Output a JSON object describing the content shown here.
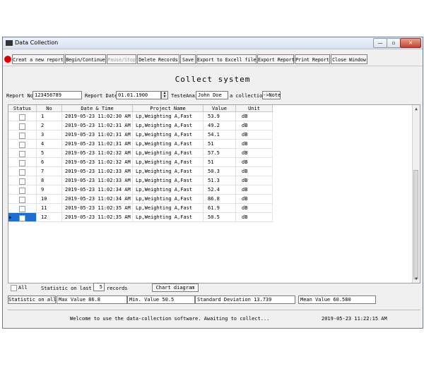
{
  "window": {
    "title": "Data Collection",
    "min": "—",
    "max": "▫",
    "close": "✕"
  },
  "toolbar": {
    "create": "Creat a new report",
    "begin": "Begin/Continue",
    "pause": "Pause/Stop",
    "delete": "Delete Records",
    "save": "Save",
    "export_excel": "Export to Excell file",
    "export_report": "Export Report",
    "print_report": "Print Report",
    "close_window": "Close Window"
  },
  "heading": "Collect system",
  "form": {
    "report_no_label": "Report No",
    "report_no_value": "123456789",
    "report_date_label": "Report Date",
    "report_date_value": "01.01.1900",
    "tester_label": "TesteAnai",
    "tester_value": "John Doe",
    "collection_label": "a collection",
    "note_button": "->Note"
  },
  "table": {
    "headers": [
      "Status",
      "No",
      "Date & Time",
      "Project Name",
      "Value",
      "Unit"
    ],
    "rows": [
      {
        "no": "1",
        "dt": "2019-05-23 11:02:30 AM",
        "project": "Lp,Weighting A,Fast",
        "value": "53.9",
        "unit": "dB"
      },
      {
        "no": "2",
        "dt": "2019-05-23 11:02:31 AM",
        "project": "Lp,Weighting A,Fast",
        "value": "49.2",
        "unit": "dB"
      },
      {
        "no": "3",
        "dt": "2019-05-23 11:02:31 AM",
        "project": "Lp,Weighting A,Fast",
        "value": "54.1",
        "unit": "dB"
      },
      {
        "no": "4",
        "dt": "2019-05-23 11:02:31 AM",
        "project": "Lp,Weighting A,Fast",
        "value": "51",
        "unit": "dB"
      },
      {
        "no": "5",
        "dt": "2019-05-23 11:02:32 AM",
        "project": "Lp,Weighting A,Fast",
        "value": "57.5",
        "unit": "dB"
      },
      {
        "no": "6",
        "dt": "2019-05-23 11:02:32 AM",
        "project": "Lp,Weighting A,Fast",
        "value": "51",
        "unit": "dB"
      },
      {
        "no": "7",
        "dt": "2019-05-23 11:02:33 AM",
        "project": "Lp,Weighting A,Fast",
        "value": "50.3",
        "unit": "dB"
      },
      {
        "no": "8",
        "dt": "2019-05-23 11:02:33 AM",
        "project": "Lp,Weighting A,Fast",
        "value": "51.3",
        "unit": "dB"
      },
      {
        "no": "9",
        "dt": "2019-05-23 11:02:34 AM",
        "project": "Lp,Weighting A,Fast",
        "value": "52.4",
        "unit": "dB"
      },
      {
        "no": "10",
        "dt": "2019-05-23 11:02:34 AM",
        "project": "Lp,Weighting A,Fast",
        "value": "86.8",
        "unit": "dB"
      },
      {
        "no": "11",
        "dt": "2019-05-23 11:02:35 AM",
        "project": "Lp,Weighting A,Fast",
        "value": "61.9",
        "unit": "dB"
      },
      {
        "no": "12",
        "dt": "2019-05-23 11:02:35 AM",
        "project": "Lp,Weighting A,Fast",
        "value": "50.5",
        "unit": "dB"
      }
    ]
  },
  "controls": {
    "all_label": "All",
    "statistic_on_last": "Statistic on last",
    "last_count": "5",
    "records": "records",
    "chart_button": "Chart diagram",
    "statistic_on_all": "Statistic on all",
    "max_label": "Max  Value",
    "max_value": "86.8",
    "min_label": "Min. Value",
    "min_value": "50.5",
    "std_label": "Standard Deviation",
    "std_value": "13.739",
    "mean_label": "Mean Value",
    "mean_value": "60.580"
  },
  "status": {
    "message": "Welcome to use the data-collection software. Awaiting to collect...",
    "time": "2019-05-23 11:22:15 AM"
  },
  "colors": {
    "record_indicator": "#e00000",
    "selection": "#1c6fd0"
  }
}
